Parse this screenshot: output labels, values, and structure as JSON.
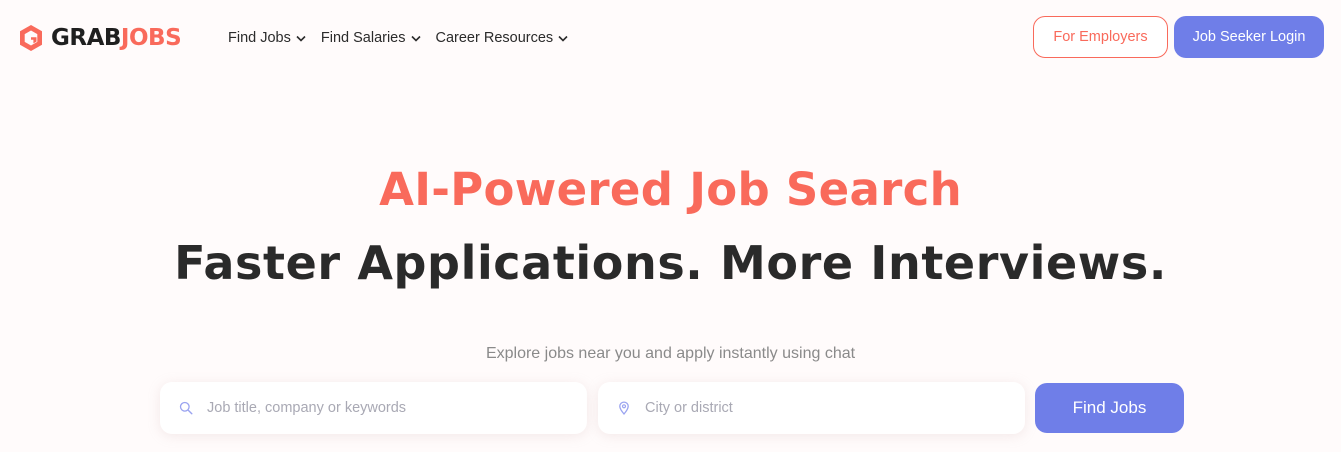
{
  "brand": {
    "name_part1": "GRAB",
    "name_part2": "JOBS",
    "primary_color": "#f96a5b",
    "accent_color": "#6f7ee8",
    "logo_icon": "grabjobs-hexagon-g-icon"
  },
  "nav": {
    "items": [
      {
        "label": "Find Jobs",
        "icon": "chevron-down-icon"
      },
      {
        "label": "Find Salaries",
        "icon": "chevron-down-icon"
      },
      {
        "label": "Career Resources",
        "icon": "chevron-down-icon"
      }
    ]
  },
  "header_actions": {
    "employers_label": "For Employers",
    "login_label": "Job Seeker Login"
  },
  "hero": {
    "title": "AI-Powered Job Search",
    "subtitle": "Faster Applications. More Interviews.",
    "tagline": "Explore jobs near you and apply instantly using chat"
  },
  "search": {
    "keywords_placeholder": "Job title, company or keywords",
    "keywords_value": "",
    "keywords_icon": "search-icon",
    "location_placeholder": "City or district",
    "location_value": "",
    "location_icon": "location-pin-icon",
    "button_label": "Find Jobs"
  }
}
